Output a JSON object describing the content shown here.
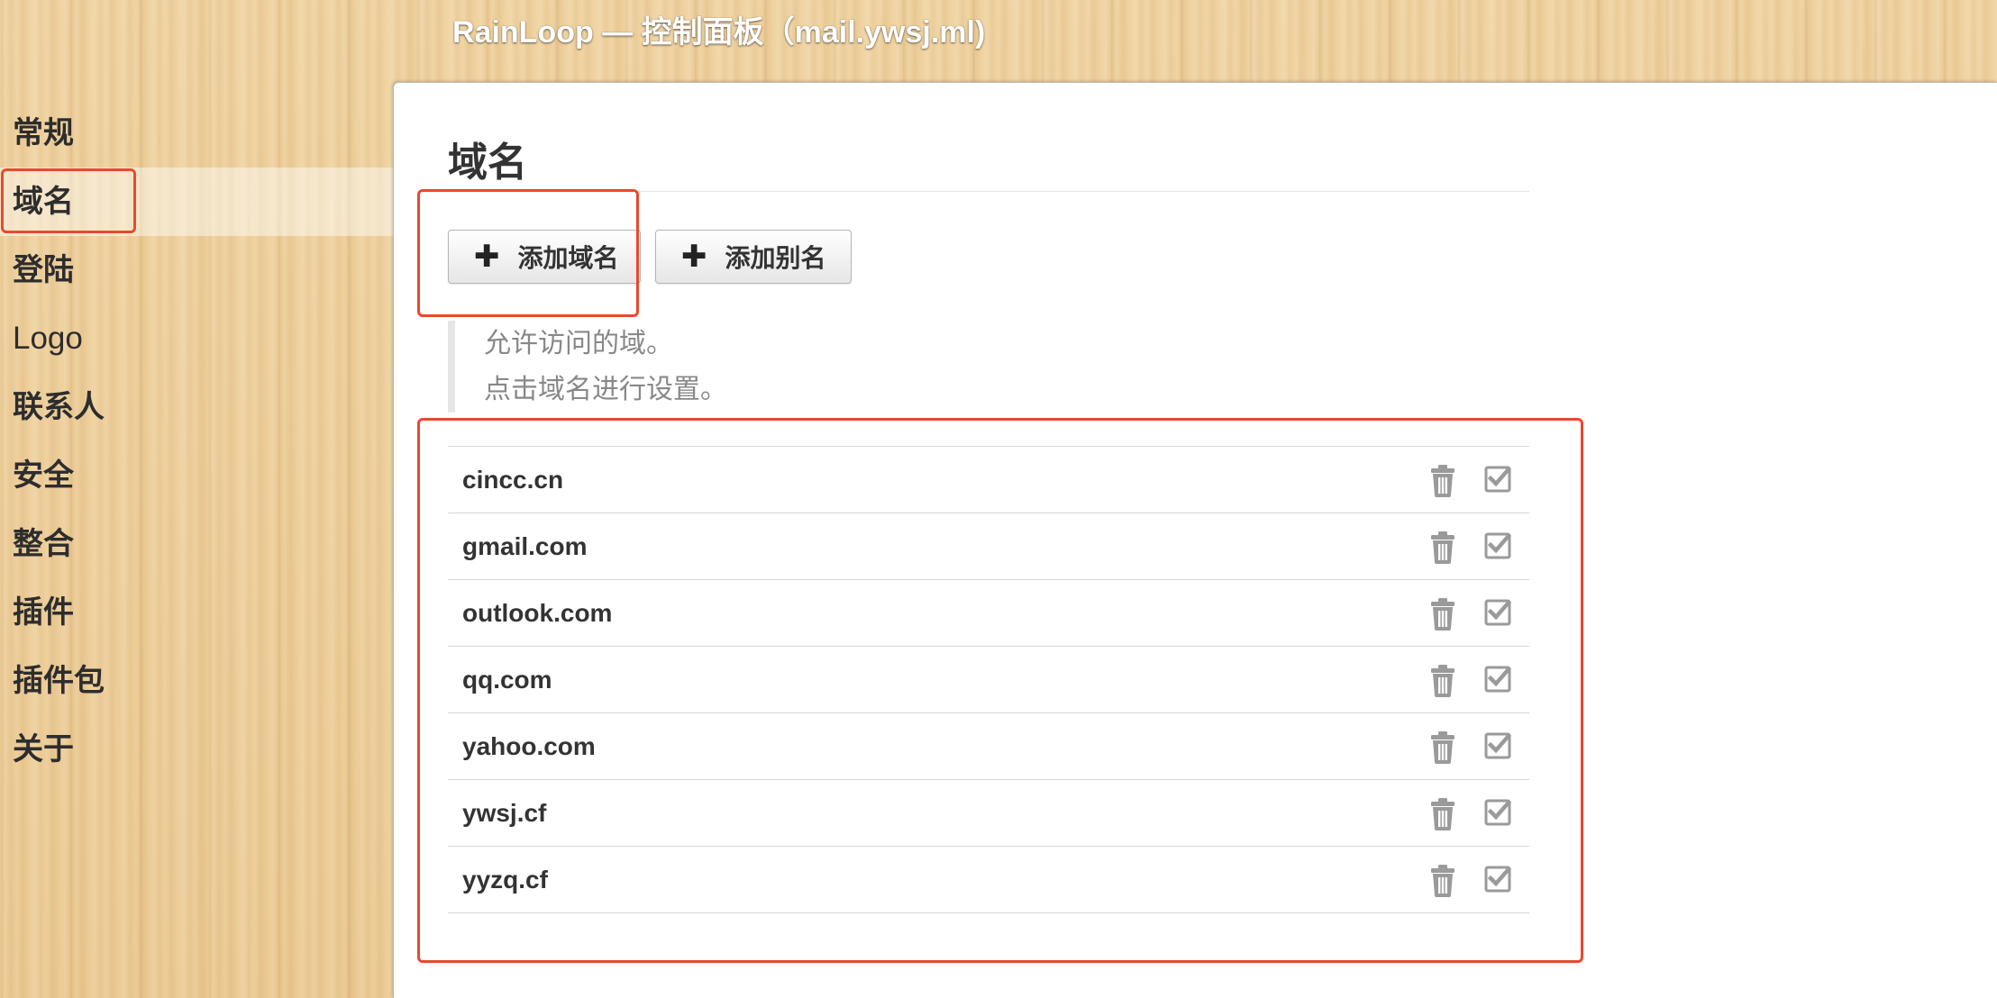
{
  "window": {
    "title": "RainLoop — 控制面板（mail.ywsj.ml)"
  },
  "sidebar": {
    "items": [
      {
        "label": "常规",
        "active": false
      },
      {
        "label": "域名",
        "active": true
      },
      {
        "label": "登陆",
        "active": false
      },
      {
        "label": "Logo",
        "active": false
      },
      {
        "label": "联系人",
        "active": false
      },
      {
        "label": "安全",
        "active": false
      },
      {
        "label": "整合",
        "active": false
      },
      {
        "label": "插件",
        "active": false
      },
      {
        "label": "插件包",
        "active": false
      },
      {
        "label": "关于",
        "active": false
      }
    ]
  },
  "main": {
    "title": "域名",
    "buttons": {
      "add_domain": "添加域名",
      "add_alias": "添加别名"
    },
    "hint": {
      "line1": "允许访问的域。",
      "line2": "点击域名进行设置。"
    },
    "domains": [
      {
        "name": "cincc.cn",
        "enabled": true
      },
      {
        "name": "gmail.com",
        "enabled": true
      },
      {
        "name": "outlook.com",
        "enabled": true
      },
      {
        "name": "qq.com",
        "enabled": true
      },
      {
        "name": "yahoo.com",
        "enabled": true
      },
      {
        "name": "ywsj.cf",
        "enabled": true
      },
      {
        "name": "yyzq.cf",
        "enabled": true
      }
    ]
  },
  "icons": {
    "add": "plus-icon",
    "delete": "trash-icon",
    "enabled": "checkbox-checked-icon"
  },
  "colors": {
    "highlight": "#e84a2c",
    "icon_gray": "#9a9a9a",
    "hint_text": "#888888"
  }
}
